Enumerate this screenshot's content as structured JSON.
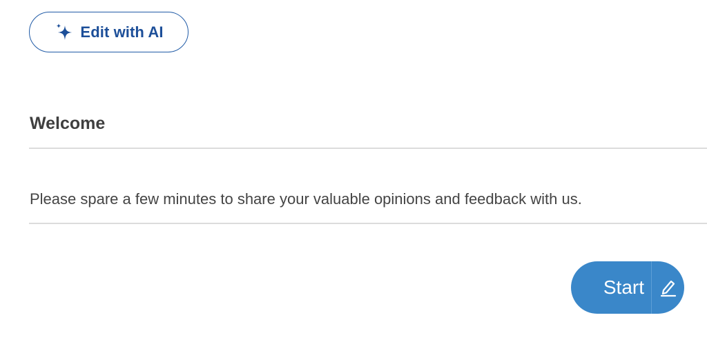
{
  "ai_button": {
    "label": "Edit with AI",
    "icon": "sparkle-icon",
    "color": "#1d4f99"
  },
  "welcome": {
    "title": "Welcome",
    "description": "Please spare a few minutes to share your valuable opinions and feedback with us."
  },
  "start_button": {
    "label": "Start",
    "icon": "pencil-icon",
    "color": "#3a87c9"
  }
}
